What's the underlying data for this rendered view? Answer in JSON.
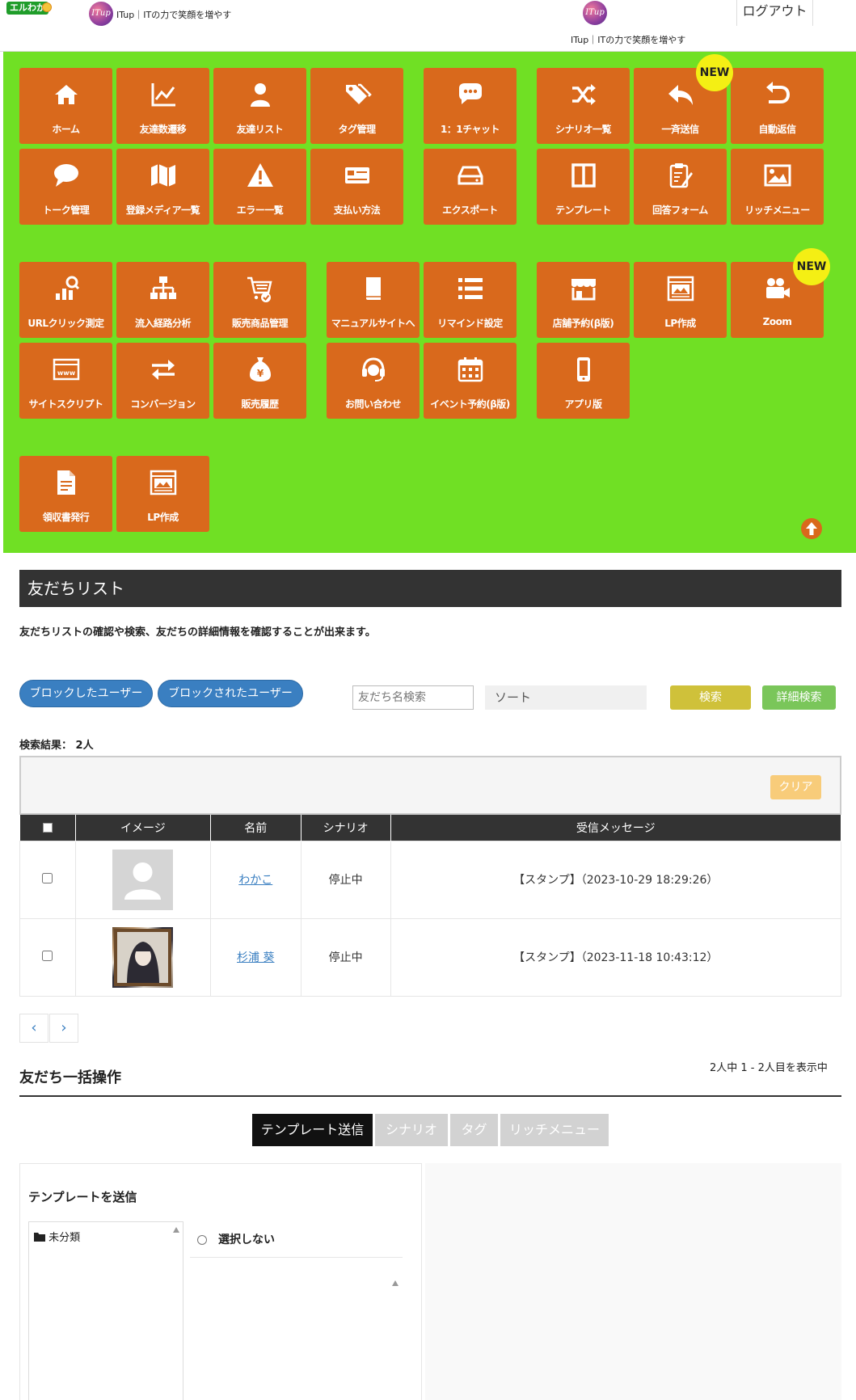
{
  "header": {
    "site_badge": "エルわか",
    "brand_logo_text": "ITup",
    "brand_text": "ITup｜ITの力で笑顔を増やす",
    "logout_label": "ログアウト"
  },
  "menu": {
    "accent_color": "#d9691c",
    "background_color": "#70e024",
    "tiles": [
      {
        "label": "ホーム",
        "icon": "home-icon"
      },
      {
        "label": "友達数遷移",
        "icon": "line-chart-icon"
      },
      {
        "label": "友達リスト",
        "icon": "user-icon"
      },
      {
        "label": "タグ管理",
        "icon": "tags-icon"
      },
      {
        "label": "1：1チャット",
        "icon": "chat-bubble-icon"
      },
      {
        "label": "シナリオ一覧",
        "icon": "shuffle-icon"
      },
      {
        "label": "一斉送信",
        "icon": "reply-icon"
      },
      {
        "label": "自動返信",
        "icon": "return-arrow-icon"
      },
      {
        "label": "トーク管理",
        "icon": "speech-bubble-icon"
      },
      {
        "label": "登録メディア一覧",
        "icon": "map-icon"
      },
      {
        "label": "エラー一覧",
        "icon": "warning-icon"
      },
      {
        "label": "支払い方法",
        "icon": "credit-card-icon"
      },
      {
        "label": "エクスポート",
        "icon": "hard-drive-icon"
      },
      {
        "label": "テンプレート",
        "icon": "columns-icon"
      },
      {
        "label": "回答フォーム",
        "icon": "clipboard-pen-icon"
      },
      {
        "label": "リッチメニュー",
        "icon": "image-icon"
      },
      {
        "label": "URLクリック測定",
        "icon": "click-stats-icon"
      },
      {
        "label": "流入経路分析",
        "icon": "sitemap-icon"
      },
      {
        "label": "販売商品管理",
        "icon": "cart-check-icon"
      },
      {
        "label": "マニュアルサイトへ",
        "icon": "book-icon"
      },
      {
        "label": "リマインド設定",
        "icon": "list-icon"
      },
      {
        "label": "店舗予約(β版)",
        "icon": "store-icon"
      },
      {
        "label": "LP作成",
        "icon": "web-page-icon"
      },
      {
        "label": "Zoom",
        "icon": "video-camera-icon"
      },
      {
        "label": "サイトスクリプト",
        "icon": "www-window-icon"
      },
      {
        "label": "コンバージョン",
        "icon": "exchange-icon"
      },
      {
        "label": "販売履歴",
        "icon": "money-bag-icon"
      },
      {
        "label": "お問い合わせ",
        "icon": "headset-icon"
      },
      {
        "label": "イベント予約(β版)",
        "icon": "calendar-icon"
      },
      {
        "label": "アプリ版",
        "icon": "smartphone-icon"
      },
      {
        "label": "領収書発行",
        "icon": "receipt-icon"
      },
      {
        "label": "LP作成",
        "icon": "web-page-icon"
      }
    ],
    "new_badge": "NEW",
    "scroll_top_icon": "arrow-up-circle-icon"
  },
  "page": {
    "title": "友だちリスト",
    "description": "友だちリストの確認や検索、友だちの詳細情報を確認することが出来ます。",
    "blocked_users_label": "ブロックしたユーザー",
    "blocked_by_users_label": "ブロックされたユーザー",
    "search_placeholder": "友だち名検索",
    "sort_label": "ソート",
    "search_button": "検索",
    "detail_search_button": "詳細検索",
    "result_count": "検索結果： 2人",
    "clear_button": "クリア"
  },
  "table": {
    "headers": [
      "イメージ",
      "名前",
      "シナリオ",
      "受信メッセージ"
    ],
    "rows": [
      {
        "name": "わかこ",
        "scenario": "停止中",
        "message": "【スタンプ】（2023-10-29 18:29:26）",
        "image": "default-avatar"
      },
      {
        "name": "杉浦 葵",
        "scenario": "停止中",
        "message": "【スタンプ】（2023-11-18 10:43:12）",
        "image": "photo-avatar"
      }
    ]
  },
  "pagination": {
    "prev": "‹",
    "next": "›",
    "info": "2人中 1 - 2人目を表示中"
  },
  "bulk": {
    "title": "友だち一括操作",
    "tabs": [
      "テンプレート送信",
      "シナリオ",
      "タグ",
      "リッチメニュー"
    ],
    "template_title": "テンプレートを送信",
    "folder": "未分類",
    "radio_none": "選択しない"
  }
}
